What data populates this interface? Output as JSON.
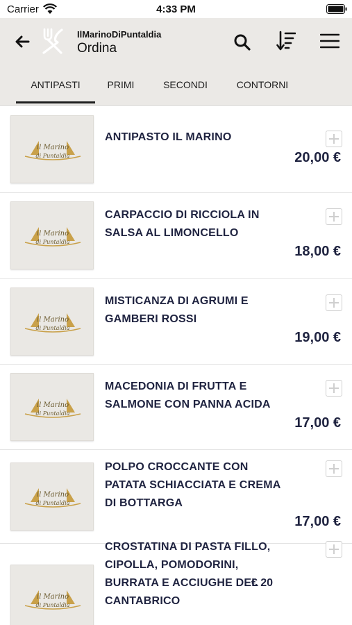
{
  "status_bar": {
    "carrier": "Carrier",
    "time": "4:33 PM",
    "icons": [
      "wifi-icon",
      "battery-icon"
    ]
  },
  "header": {
    "app_name": "IlMarinoDiPuntaldia",
    "title": "Ordina",
    "icons": [
      "back-arrow-icon",
      "utensils-icon",
      "search-icon",
      "sort-icon",
      "menu-icon"
    ]
  },
  "tabs": [
    {
      "label": "ANTIPASTI",
      "active": true
    },
    {
      "label": "PRIMI",
      "active": false
    },
    {
      "label": "SECONDI",
      "active": false
    },
    {
      "label": "CONTORNI",
      "active": false
    }
  ],
  "thumbnail_logo": {
    "line1": "il Marino",
    "line2": "di Puntaldia"
  },
  "items": [
    {
      "name": "ANTIPASTO IL MARINO",
      "price": "20,00 €"
    },
    {
      "name": "CARPACCIO DI RICCIOLA IN SALSA AL LIMONCELLO",
      "price": "18,00 €"
    },
    {
      "name": "MISTICANZA DI AGRUMI E GAMBERI ROSSI",
      "price": "19,00 €"
    },
    {
      "name": "MACEDONIA DI FRUTTA E SALMONE CON PANNA ACIDA",
      "price": "17,00 €"
    },
    {
      "name": "POLPO CROCCANTE CON PATATA SCHIACCIATA E CREMA DI BOTTARGA",
      "price": "17,00 €"
    },
    {
      "name": "CROSTATINA DI PASTA FILLO, CIPOLLA, POMODORINI, BURRATA E ACCIUGHE DEL CANTABRICO",
      "price": "€ 20"
    }
  ],
  "colors": {
    "header_bg": "#ebe9e6",
    "text_dark": "#1f2340",
    "logo_gold": "#c9a14a"
  }
}
